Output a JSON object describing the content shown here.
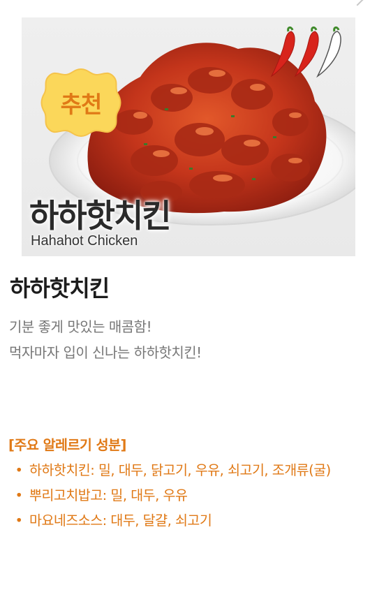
{
  "hero": {
    "badge": "추천",
    "title_ko": "하하핫치킨",
    "title_en": "Hahahot Chicken",
    "spice_level": 2,
    "spice_max": 3,
    "colors": {
      "pepper_hot": "#d8241c",
      "pepper_empty": "#ffffff",
      "badge_fill": "#fbd75a",
      "badge_text": "#e07916",
      "chicken": "#c4351b"
    }
  },
  "product": {
    "name": "하하핫치킨",
    "description": [
      "기분 좋게 맛있는 매콤함!",
      "먹자마자 입이 신나는 하하핫치킨!"
    ]
  },
  "allergy": {
    "title": "[주요 알레르기 성분]",
    "bullet": "•",
    "items": [
      "하하핫치킨: 밀, 대두, 닭고기, 우유, 쇠고기, 조개류(굴)",
      "뿌리고치밥고: 밀, 대두, 우유",
      "마요네즈소스: 대두, 달걀, 쇠고기"
    ]
  }
}
